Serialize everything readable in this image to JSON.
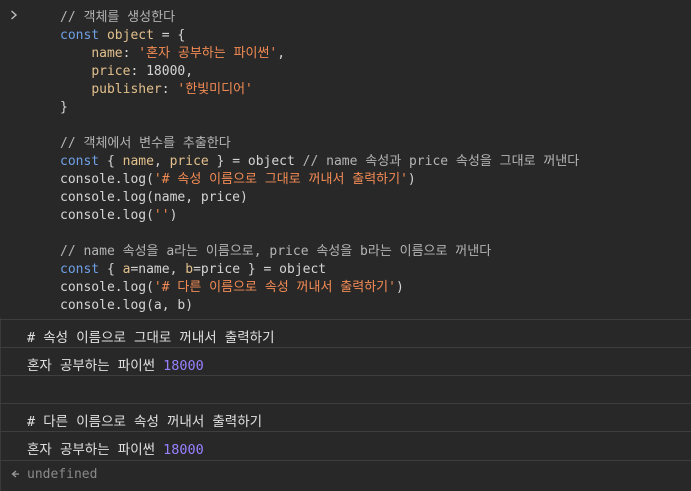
{
  "input": {
    "prompt_icon": "chevron-right-icon",
    "lines": [
      [
        {
          "t": "comment",
          "v": "// 객체를 생성한다"
        }
      ],
      [
        {
          "t": "keyword",
          "v": "const "
        },
        {
          "t": "var",
          "v": "object"
        },
        {
          "t": "plain",
          "v": " = {"
        }
      ],
      [
        {
          "t": "plain",
          "v": "    "
        },
        {
          "t": "key",
          "v": "name"
        },
        {
          "t": "plain",
          "v": ": "
        },
        {
          "t": "string",
          "v": "'혼자 공부하는 파이썬'"
        },
        {
          "t": "plain",
          "v": ","
        }
      ],
      [
        {
          "t": "plain",
          "v": "    "
        },
        {
          "t": "key",
          "v": "price"
        },
        {
          "t": "plain",
          "v": ": "
        },
        {
          "t": "number",
          "v": "18000"
        },
        {
          "t": "plain",
          "v": ","
        }
      ],
      [
        {
          "t": "plain",
          "v": "    "
        },
        {
          "t": "key",
          "v": "publisher"
        },
        {
          "t": "plain",
          "v": ": "
        },
        {
          "t": "string",
          "v": "'한빛미디어'"
        }
      ],
      [
        {
          "t": "plain",
          "v": "}"
        }
      ],
      [
        {
          "t": "plain",
          "v": ""
        }
      ],
      [
        {
          "t": "comment",
          "v": "// 객체에서 변수를 추출한다"
        }
      ],
      [
        {
          "t": "keyword",
          "v": "const "
        },
        {
          "t": "plain",
          "v": "{ "
        },
        {
          "t": "var",
          "v": "name"
        },
        {
          "t": "plain",
          "v": ", "
        },
        {
          "t": "var",
          "v": "price"
        },
        {
          "t": "plain",
          "v": " } = object "
        },
        {
          "t": "comment",
          "v": "// name 속성과 price 속성을 그대로 꺼낸다"
        }
      ],
      [
        {
          "t": "plain",
          "v": "console.log("
        },
        {
          "t": "string",
          "v": "'# 속성 이름으로 그대로 꺼내서 출력하기'"
        },
        {
          "t": "plain",
          "v": ")"
        }
      ],
      [
        {
          "t": "plain",
          "v": "console.log(name, price)"
        }
      ],
      [
        {
          "t": "plain",
          "v": "console.log("
        },
        {
          "t": "string",
          "v": "''"
        },
        {
          "t": "plain",
          "v": ")"
        }
      ],
      [
        {
          "t": "plain",
          "v": ""
        }
      ],
      [
        {
          "t": "comment",
          "v": "// name 속성을 a라는 이름으로, price 속성을 b라는 이름으로 꺼낸다"
        }
      ],
      [
        {
          "t": "keyword",
          "v": "const "
        },
        {
          "t": "plain",
          "v": "{ "
        },
        {
          "t": "var",
          "v": "a"
        },
        {
          "t": "plain",
          "v": "=name, "
        },
        {
          "t": "var",
          "v": "b"
        },
        {
          "t": "plain",
          "v": "=price } = object"
        }
      ],
      [
        {
          "t": "plain",
          "v": "console.log("
        },
        {
          "t": "string",
          "v": "'# 다른 이름으로 속성 꺼내서 출력하기'"
        },
        {
          "t": "plain",
          "v": ")"
        }
      ],
      [
        {
          "t": "plain",
          "v": "console.log(a, b)"
        }
      ]
    ]
  },
  "outputs": [
    {
      "text": "# 속성 이름으로 그대로 꺼내서 출력하기",
      "num": ""
    },
    {
      "text": "혼자 공부하는 파이썬 ",
      "num": "18000"
    },
    {
      "text": "",
      "num": ""
    },
    {
      "text": "# 다른 이름으로 속성 꺼내서 출력하기",
      "num": ""
    },
    {
      "text": "혼자 공부하는 파이썬 ",
      "num": "18000"
    }
  ],
  "result": {
    "icon": "return-arrow-icon",
    "text": "undefined"
  }
}
